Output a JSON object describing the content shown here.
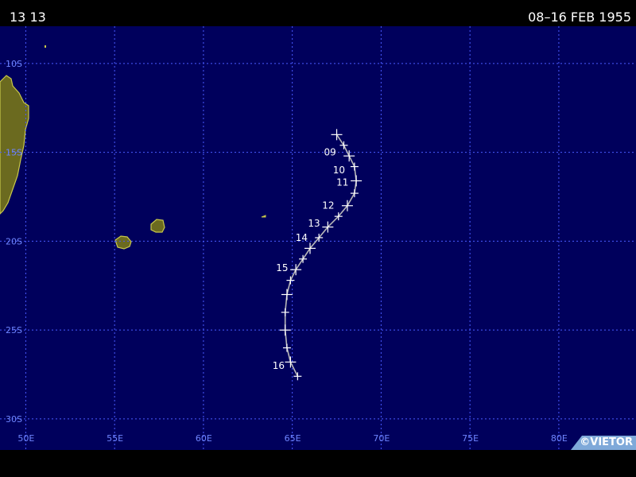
{
  "header": {
    "storm_id": "13 13",
    "date_range": "08–16 FEB 1955"
  },
  "map": {
    "lat_labels": [
      "10S",
      "15S",
      "20S",
      "25S",
      "30S"
    ],
    "lon_labels": [
      "50E",
      "55E",
      "60E",
      "65E",
      "70E",
      "75E",
      "80E"
    ],
    "colors": {
      "ocean": "#00005c",
      "grid": "#4a5bff",
      "grid_label": "#6f86ff",
      "land": "#6b6a1f",
      "coast": "#c8c84a",
      "track": "#b8b8b8",
      "marker": "#ffffff"
    },
    "credit": "©VIETOR",
    "track": {
      "points": [
        {
          "lat": -14.0,
          "lon": 67.5
        },
        {
          "lat": -14.6,
          "lon": 67.9
        },
        {
          "lat": -15.2,
          "lon": 68.2
        },
        {
          "lat": -15.8,
          "lon": 68.5
        },
        {
          "lat": -16.6,
          "lon": 68.6
        },
        {
          "lat": -17.3,
          "lon": 68.5
        },
        {
          "lat": -18.0,
          "lon": 68.1
        },
        {
          "lat": -18.6,
          "lon": 67.6
        },
        {
          "lat": -19.2,
          "lon": 67.0
        },
        {
          "lat": -19.8,
          "lon": 66.5
        },
        {
          "lat": -20.4,
          "lon": 66.0
        },
        {
          "lat": -21.0,
          "lon": 65.6
        },
        {
          "lat": -21.6,
          "lon": 65.2
        },
        {
          "lat": -22.2,
          "lon": 64.9
        },
        {
          "lat": -23.0,
          "lon": 64.7
        },
        {
          "lat": -24.0,
          "lon": 64.6
        },
        {
          "lat": -25.0,
          "lon": 64.6
        },
        {
          "lat": -26.0,
          "lon": 64.7
        },
        {
          "lat": -26.8,
          "lon": 64.9
        },
        {
          "lat": -27.6,
          "lon": 65.3
        }
      ],
      "day_labels": [
        {
          "text": "09",
          "lat": -15.0,
          "lon": 67.5
        },
        {
          "text": "10",
          "lat": -16.0,
          "lon": 68.0
        },
        {
          "text": "11",
          "lat": -16.7,
          "lon": 68.2
        },
        {
          "text": "12",
          "lat": -18.0,
          "lon": 67.4
        },
        {
          "text": "13",
          "lat": -19.0,
          "lon": 66.6
        },
        {
          "text": "14",
          "lat": -19.8,
          "lon": 65.9
        },
        {
          "text": "15",
          "lat": -21.5,
          "lon": 64.8
        },
        {
          "text": "16",
          "lat": -27.0,
          "lon": 64.6
        }
      ]
    }
  }
}
